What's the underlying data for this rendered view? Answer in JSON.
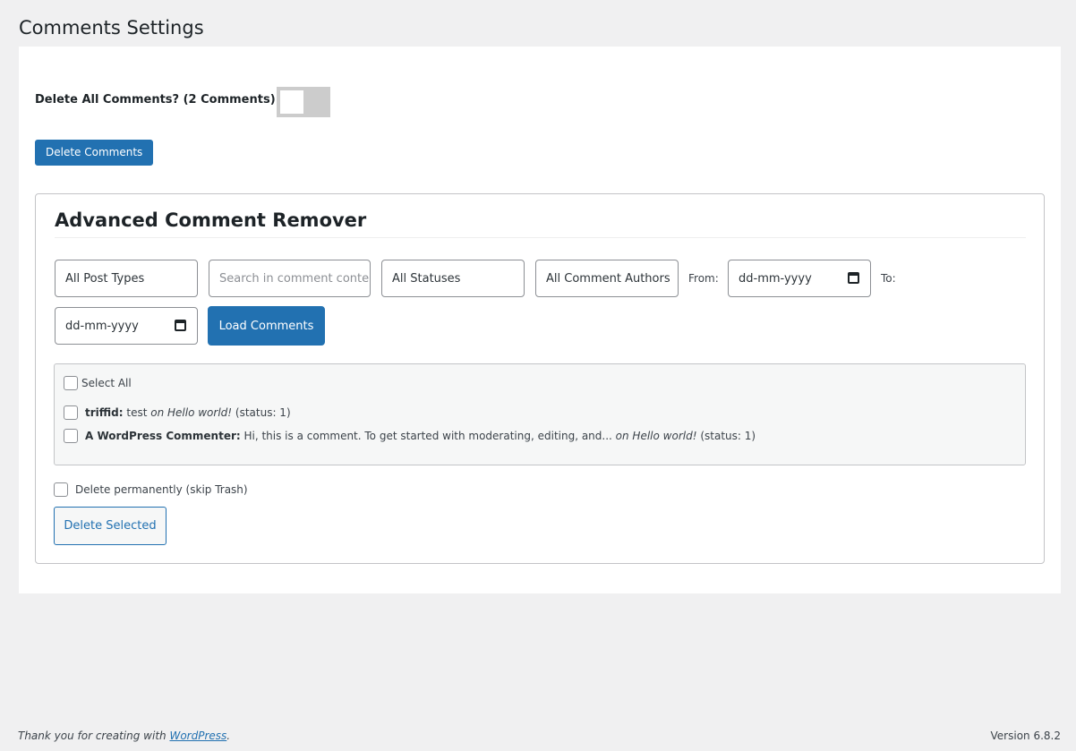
{
  "page": {
    "title": "Comments Settings"
  },
  "settings": {
    "delete_all_label": "Delete All Comments? (2 Comments)",
    "delete_all_enabled": false,
    "delete_button": "Delete Comments"
  },
  "remover": {
    "title": "Advanced Comment Remover",
    "filters": {
      "post_type": "All Post Types",
      "search_placeholder": "Search in comment content",
      "status": "All Statuses",
      "author": "All Comment Authors",
      "from_label": "From:",
      "from_date": "dd-mm-yyyy",
      "to_label": "To:",
      "to_date": "dd-mm-yyyy"
    },
    "load_button": "Load Comments",
    "select_all_label": "Select All",
    "comments": [
      {
        "author": "triffid:",
        "excerpt": " test ",
        "on_label": "on Hello world!",
        "status": " (status: 1)"
      },
      {
        "author": "A WordPress Commenter:",
        "excerpt": " Hi, this is a comment. To get started with moderating, editing, and... ",
        "on_label": "on Hello world!",
        "status": " (status: 1)"
      }
    ],
    "delete_permanently_label": "Delete permanently (skip Trash)",
    "delete_selected_button": "Delete Selected"
  },
  "footer": {
    "thanks_prefix": "Thank you for creating with ",
    "wordpress_link": "WordPress",
    "thanks_suffix": ".",
    "version": "Version 6.8.2"
  },
  "colors": {
    "accent": "#2271b1",
    "background": "#f0f0f1",
    "toggle_off": "#cccccc"
  }
}
